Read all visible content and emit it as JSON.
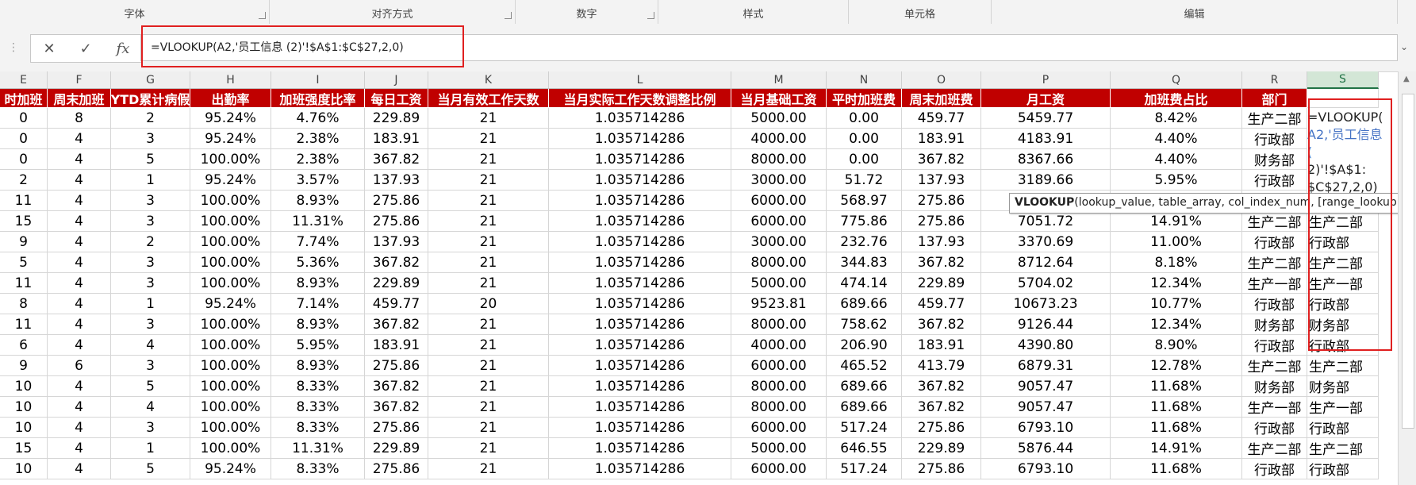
{
  "ribbon": {
    "groups": [
      "字体",
      "对齐方式",
      "数字",
      "样式",
      "单元格",
      "编辑"
    ]
  },
  "formula_bar": {
    "cancel_icon": "✕",
    "enter_icon": "✓",
    "fx_icon": "fx",
    "formula": "=VLOOKUP(A2,'员工信息 (2)'!$A$1:$C$27,2,0)"
  },
  "columns": [
    "E",
    "F",
    "G",
    "H",
    "I",
    "J",
    "K",
    "L",
    "M",
    "N",
    "O",
    "P",
    "Q",
    "R",
    "S"
  ],
  "selected_column": "S",
  "headers": [
    "时加班",
    "周末加班",
    "YTD累计病假",
    "出勤率",
    "加班强度比率",
    "每日工资",
    "当月有效工作天数",
    "当月实际工作天数调整比例",
    "当月基础工资",
    "平时加班费",
    "周末加班费",
    "月工资",
    "加班费占比",
    "部门",
    ""
  ],
  "rows": [
    [
      "0",
      "8",
      "2",
      "95.24%",
      "4.76%",
      "229.89",
      "21",
      "1.035714286",
      "5000.00",
      "0.00",
      "459.77",
      "5459.77",
      "8.42%",
      "生产二部",
      ""
    ],
    [
      "0",
      "4",
      "3",
      "95.24%",
      "2.38%",
      "183.91",
      "21",
      "1.035714286",
      "4000.00",
      "0.00",
      "183.91",
      "4183.91",
      "4.40%",
      "行政部",
      ""
    ],
    [
      "0",
      "4",
      "5",
      "100.00%",
      "2.38%",
      "367.82",
      "21",
      "1.035714286",
      "8000.00",
      "0.00",
      "367.82",
      "8367.66",
      "4.40%",
      "财务部",
      ""
    ],
    [
      "2",
      "4",
      "1",
      "95.24%",
      "3.57%",
      "137.93",
      "21",
      "1.035714286",
      "3000.00",
      "51.72",
      "137.93",
      "3189.66",
      "5.95%",
      "行政部",
      ""
    ],
    [
      "11",
      "4",
      "3",
      "100.00%",
      "8.93%",
      "275.86",
      "21",
      "1.035714286",
      "6000.00",
      "568.97",
      "275.86",
      "",
      "",
      "",
      ""
    ],
    [
      "15",
      "4",
      "3",
      "100.00%",
      "11.31%",
      "275.86",
      "21",
      "1.035714286",
      "6000.00",
      "775.86",
      "275.86",
      "7051.72",
      "14.91%",
      "生产二部",
      "生产二部"
    ],
    [
      "9",
      "4",
      "2",
      "100.00%",
      "7.74%",
      "137.93",
      "21",
      "1.035714286",
      "3000.00",
      "232.76",
      "137.93",
      "3370.69",
      "11.00%",
      "行政部",
      "行政部"
    ],
    [
      "5",
      "4",
      "3",
      "100.00%",
      "5.36%",
      "367.82",
      "21",
      "1.035714286",
      "8000.00",
      "344.83",
      "367.82",
      "8712.64",
      "8.18%",
      "生产二部",
      "生产二部"
    ],
    [
      "11",
      "4",
      "3",
      "100.00%",
      "8.93%",
      "229.89",
      "21",
      "1.035714286",
      "5000.00",
      "474.14",
      "229.89",
      "5704.02",
      "12.34%",
      "生产一部",
      "生产一部"
    ],
    [
      "8",
      "4",
      "1",
      "95.24%",
      "7.14%",
      "459.77",
      "20",
      "1.035714286",
      "9523.81",
      "689.66",
      "459.77",
      "10673.23",
      "10.77%",
      "行政部",
      "行政部"
    ],
    [
      "11",
      "4",
      "3",
      "100.00%",
      "8.93%",
      "367.82",
      "21",
      "1.035714286",
      "8000.00",
      "758.62",
      "367.82",
      "9126.44",
      "12.34%",
      "财务部",
      "财务部"
    ],
    [
      "6",
      "4",
      "4",
      "100.00%",
      "5.95%",
      "183.91",
      "21",
      "1.035714286",
      "4000.00",
      "206.90",
      "183.91",
      "4390.80",
      "8.90%",
      "行政部",
      "行政部"
    ],
    [
      "9",
      "6",
      "3",
      "100.00%",
      "8.93%",
      "275.86",
      "21",
      "1.035714286",
      "6000.00",
      "465.52",
      "413.79",
      "6879.31",
      "12.78%",
      "生产二部",
      "生产二部"
    ],
    [
      "10",
      "4",
      "5",
      "100.00%",
      "8.33%",
      "367.82",
      "21",
      "1.035714286",
      "8000.00",
      "689.66",
      "367.82",
      "9057.47",
      "11.68%",
      "财务部",
      "财务部"
    ],
    [
      "10",
      "4",
      "4",
      "100.00%",
      "8.33%",
      "367.82",
      "21",
      "1.035714286",
      "8000.00",
      "689.66",
      "367.82",
      "9057.47",
      "11.68%",
      "生产一部",
      "生产一部"
    ],
    [
      "10",
      "4",
      "3",
      "100.00%",
      "8.33%",
      "275.86",
      "21",
      "1.035714286",
      "6000.00",
      "517.24",
      "275.86",
      "6793.10",
      "11.68%",
      "行政部",
      "行政部"
    ],
    [
      "15",
      "4",
      "1",
      "100.00%",
      "11.31%",
      "229.89",
      "21",
      "1.035714286",
      "5000.00",
      "646.55",
      "229.89",
      "5876.44",
      "14.91%",
      "生产二部",
      "生产二部"
    ],
    [
      "10",
      "4",
      "5",
      "95.24%",
      "8.33%",
      "275.86",
      "21",
      "1.035714286",
      "6000.00",
      "517.24",
      "275.86",
      "6793.10",
      "11.68%",
      "行政部",
      "行政部"
    ]
  ],
  "cell_editor": {
    "lines": [
      "=VLOOKUP(",
      "A2,'员工信息 (",
      "2)'!$A$1:",
      "$C$27,2,0)"
    ]
  },
  "tooltip": {
    "fn": "VLOOKUP",
    "args": "(lookup_value, table_array, col_index_num, [range_lookup])"
  },
  "colors": {
    "header_bg": "#c00000",
    "highlight": "#e02020",
    "ref_blue": "#4472c4"
  }
}
